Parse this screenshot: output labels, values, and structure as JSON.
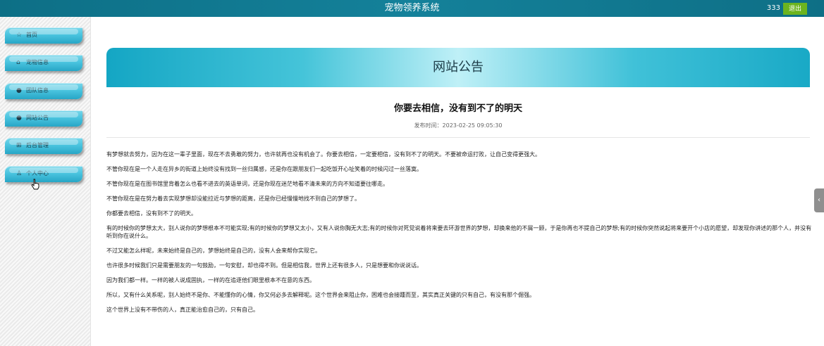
{
  "header": {
    "title": "宠物领养系统",
    "user": "333",
    "logout_label": "退出"
  },
  "sidebar": {
    "items": [
      {
        "icon": "☆",
        "label": "首页"
      },
      {
        "icon": "⌂",
        "label": "宠物信息"
      },
      {
        "icon": "●",
        "label": "团队信息"
      },
      {
        "icon": "●",
        "label": "网站公告"
      },
      {
        "icon": "⊞",
        "label": "后台管理"
      },
      {
        "icon": "♙",
        "label": "个人中心"
      }
    ]
  },
  "main": {
    "banner_title": "网站公告",
    "article": {
      "title": "你要去相信，没有到不了的明天",
      "publish_label": "发布时间：",
      "publish_time": "2023-02-25 09:05:30",
      "paragraphs": [
        "有梦想就去努力，因为在这一辈子里面，现在不去勇敢的努力，也许就再也没有机会了。你要去相信，一定要相信，没有到不了的明天。不要被命运打败，让自己变得更强大。",
        "不管你现在是一个人走在异乡的街道上始终没有找到一丝归属感，还是你在跟朋友们一起吃饭开心址笑着的时候闪过一丝落寞。",
        "不管你现在是在图书馆里背着怎么也看不进去的英语单词，还是你现在迷茫地看不清未来的方向不知道要往哪走。",
        "不管你现在是在努力着去实现梦想却没能拉近与梦想的距离，还是你已经慢慢地找不到自己的梦想了。",
        "你都要去相信，没有到不了的明天。",
        "有的时候你的梦想太大，别人说你的梦想根本不可能实现;有的时候你的梦想又太小，又有人说你胸无大志;有的时候你对死党说着将来要去环游世界的梦想，却换来他的不屑一顾，于是你再也不提自己的梦想;有的时候你突然说起将来要开个小店的愿望，却发现你讲述的那个人，并没有听到你在说什么。",
        "不过又能怎么样呢，未来始终是自己的，梦想始终是自己的，没有人会来帮你实现它。",
        "也许很多时候我们只是需要朋友的一句鼓励，一句安慰，却也得不到。但是相信我，世界上还有很多人，只是想要和你说说话。",
        "因为我们都一样。一样的被人说成固执，一样的在追逐他们眼里根本不在意的东西。",
        "所以，又有什么关系呢，别人始终不是你、不能懂你的心情，你又何必多去解释呢。这个世界会来阻止你，困难也会接踵而至，其实真正关键的只有自己，有没有那个倔强。",
        "这个世界上没有不带伤的人，真正能治愈自己的，只有自己。"
      ]
    }
  },
  "side_tab": {
    "icon": "‹"
  }
}
